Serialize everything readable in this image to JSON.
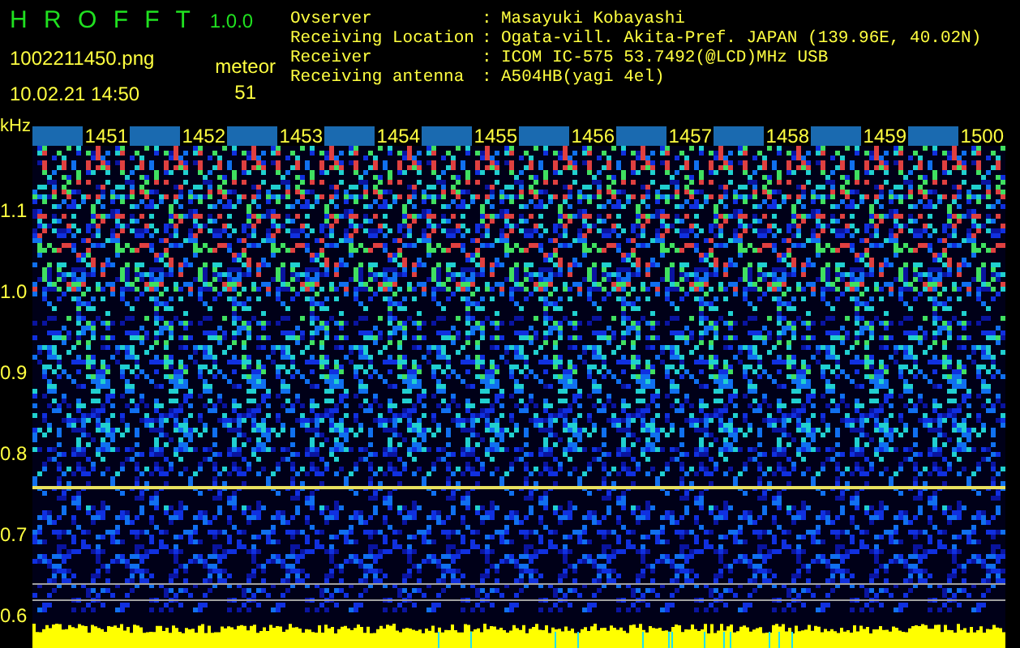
{
  "app": {
    "title": "H R O F F T",
    "version": "1.0.0"
  },
  "file": {
    "name": "1002211450.png",
    "datetime": "10.02.21 14:50"
  },
  "counter": {
    "label": "meteor",
    "value": "51"
  },
  "info": [
    {
      "label": "Ovserver",
      "separator": ":",
      "value": "Masayuki Kobayashi"
    },
    {
      "label": "Receiving Location",
      "separator": ":",
      "value": "Ogata-vill. Akita-Pref. JAPAN (139.96E, 40.02N)"
    },
    {
      "label": "Receiver",
      "separator": ":",
      "value": "ICOM IC-575 53.7492(@LCD)MHz USB"
    },
    {
      "label": "Receiving antenna",
      "separator": ":",
      "value": "A504HB(yagi 4el)"
    }
  ],
  "spectrogram": {
    "unit": "kHz",
    "time_labels": [
      "1451",
      "1452",
      "1453",
      "1454",
      "1455",
      "1456",
      "1457",
      "1458",
      "1459",
      "1500"
    ],
    "freq_labels": [
      "1.1",
      "1.0",
      "0.9",
      "0.8",
      "0.7",
      "0.6"
    ]
  }
}
